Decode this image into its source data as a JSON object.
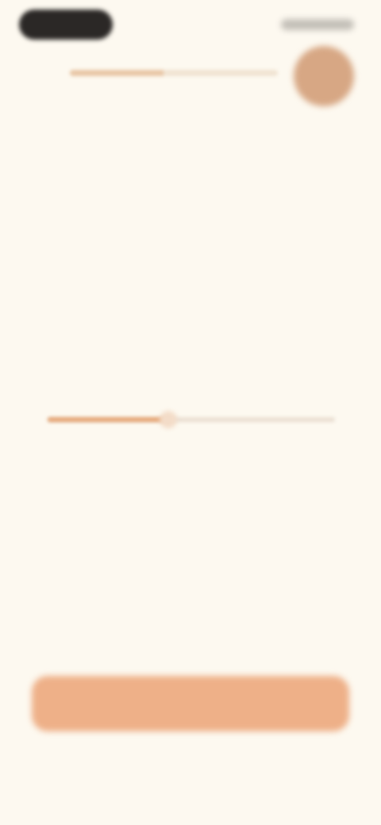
{
  "status_bar": {
    "time": "",
    "indicators": ""
  },
  "header": {
    "progress": 0.45,
    "avatar_color": "#d7a784"
  },
  "question": {
    "title": "",
    "subtitle": ""
  },
  "selection": {
    "value_text": "",
    "slider_value": 0.42,
    "min_label": "",
    "max_label": ""
  },
  "hint": {
    "text": ""
  },
  "footer": {
    "continue_label": ""
  },
  "colors": {
    "background": "#fdf9f0",
    "accent": "#eeb088",
    "accent_dark": "#e8a878",
    "text": "#2a2621",
    "muted": "#b8aea3"
  }
}
